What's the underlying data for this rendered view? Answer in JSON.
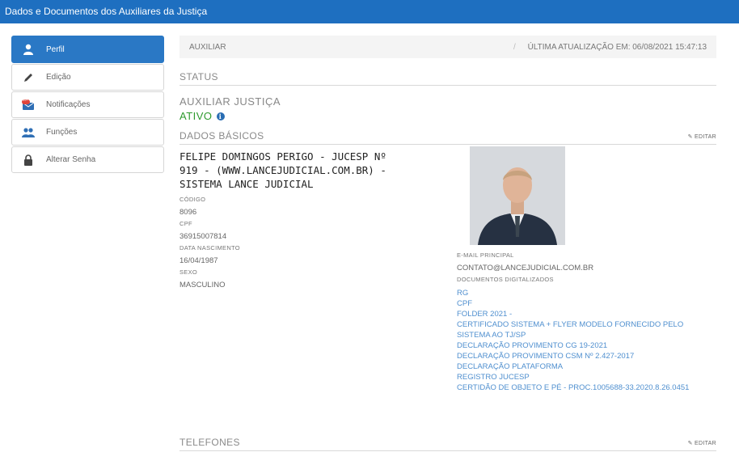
{
  "header": {
    "title": "Dados e Documentos dos Auxiliares da Justiça"
  },
  "sidebar": {
    "items": [
      {
        "label": "Perfil",
        "icon": "user-icon",
        "active": true
      },
      {
        "label": "Edição",
        "icon": "pencil-icon",
        "active": false
      },
      {
        "label": "Notificações",
        "icon": "envelope-icon",
        "active": false,
        "badge": "99+"
      },
      {
        "label": "Funções",
        "icon": "users-icon",
        "active": false
      },
      {
        "label": "Alterar Senha",
        "icon": "lock-icon",
        "active": false
      }
    ]
  },
  "status_bar": {
    "left": "AUXILIAR",
    "right": "ÚLTIMA ATUALIZAÇÃO EM: 06/08/2021 15:47:13"
  },
  "status_section": {
    "title": "STATUS",
    "type": "AUXILIAR JUSTIÇA",
    "state": "ATIVO"
  },
  "basic": {
    "title": "DADOS BÁSICOS",
    "edit_label": "EDITAR",
    "name_lines": [
      "FELIPE DOMINGOS PERIGO - JUCESP Nº",
      "919 - (WWW.LANCEJUDICIAL.COM.BR) -",
      "SISTEMA LANCE JUDICIAL"
    ],
    "fields": [
      {
        "label": "CÓDIGO",
        "value": "8096"
      },
      {
        "label": "CPF",
        "value": "36915007814"
      },
      {
        "label": "DATA NASCIMENTO",
        "value": "16/04/1987"
      },
      {
        "label": "SEXO",
        "value": "MASCULINO"
      }
    ],
    "email_label": "E-MAIL PRINCIPAL",
    "email": "CONTATO@LANCEJUDICIAL.COM.BR",
    "docs_label": "DOCUMENTOS DIGITALIZADOS",
    "documents": [
      "RG",
      "CPF",
      "FOLDER 2021 -",
      "CERTIFICADO SISTEMA + FLYER MODELO FORNECIDO PELO",
      "SISTEMA AO TJ/SP",
      "DECLARAÇÃO PROVIMENTO CG 19-2021",
      "DECLARAÇÃO PROVIMENTO CSM Nº 2.427-2017",
      "DECLARAÇÃO PLATAFORMA",
      "REGISTRO JUCESP",
      "CERTIDÃO DE OBJETO E PÉ - PROC.1005688-33.2020.8.26.0451"
    ]
  },
  "phones": {
    "title": "TELEFONES",
    "edit_label": "EDITAR"
  },
  "colors": {
    "header_bar": "#1e6fc0",
    "active_item": "#2a78c5",
    "status_active": "#2e9a2e",
    "link": "#4f8fcf"
  }
}
